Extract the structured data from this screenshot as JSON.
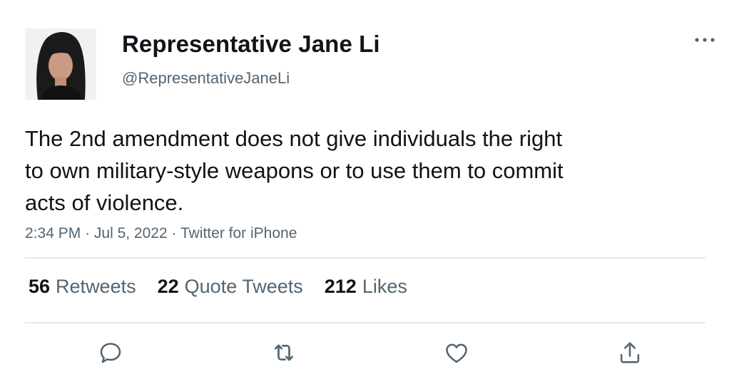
{
  "author": {
    "display_name": "Representative Jane Li",
    "handle": "@RepresentativeJaneLi",
    "avatar_icon": "profile-photo"
  },
  "tweet": {
    "text_lines": [
      "The 2nd amendment does not give individuals the right",
      "to own military-style weapons or to use them to commit",
      "acts of violence."
    ],
    "time": "2:34 PM",
    "date": "Jul 5, 2022",
    "source": "Twitter for iPhone",
    "separator": "·"
  },
  "stats": {
    "retweets": {
      "count": "56",
      "label": "Retweets"
    },
    "quote_tweets": {
      "count": "22",
      "label": "Quote Tweets"
    },
    "likes": {
      "count": "212",
      "label": "Likes"
    }
  },
  "actions": {
    "icons": [
      "reply-icon",
      "retweet-icon",
      "like-icon",
      "share-icon"
    ],
    "icon_color": "#536471"
  },
  "colors": {
    "text_primary": "#0f1419",
    "text_secondary": "#536471",
    "divider": "#e6e9eb"
  }
}
